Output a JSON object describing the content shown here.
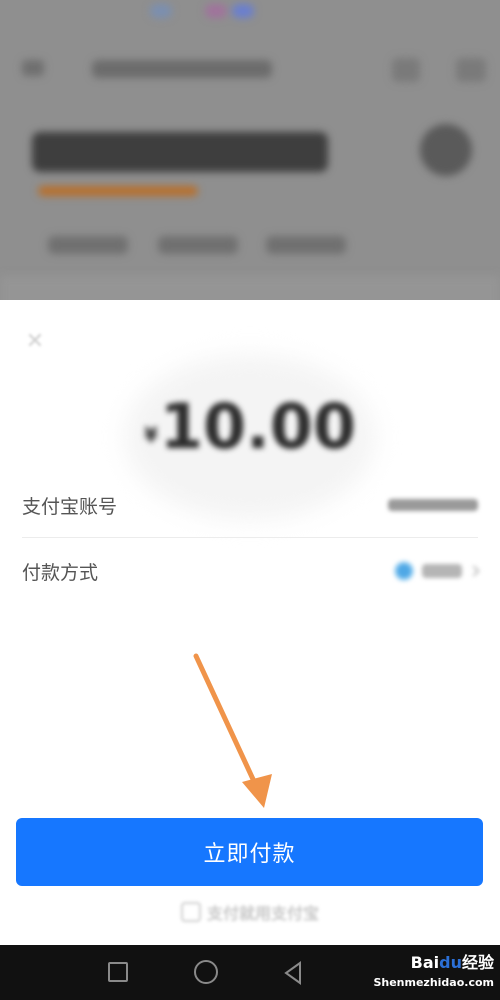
{
  "payment": {
    "currency_symbol": "¥",
    "amount": "10.00",
    "account_label": "支付宝账号",
    "method_label": "付款方式",
    "pay_button_label": "立即付款",
    "brand_text": "支付就用支付宝"
  },
  "watermark": {
    "brand": "Bai",
    "paw": "du",
    "jingyan": "经验",
    "url": "Shenmezhidao.com"
  },
  "colors": {
    "primary_button": "#1677ff",
    "annotation_arrow": "#f0944a",
    "overlay": "#8f8f8f"
  },
  "icons": {
    "close": "close-icon",
    "pay_method": "huabei-icon",
    "chevron": "chevron-right-icon",
    "arrow": "annotation-arrow-icon"
  }
}
